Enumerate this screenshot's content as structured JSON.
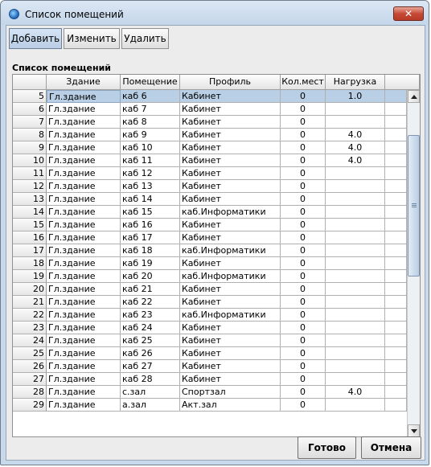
{
  "window": {
    "title": "Список помещений",
    "close_label": "✕"
  },
  "toolbar": {
    "add_label": "Добавить",
    "edit_label": "Изменить",
    "delete_label": "Удалить"
  },
  "group_label": "Список помещений",
  "table": {
    "columns": [
      "",
      "Здание",
      "Помещение",
      "Профиль",
      "Кол.мест",
      "Нагрузка"
    ],
    "selected_row": 0,
    "rows": [
      {
        "num": "5",
        "building": "Гл.здание",
        "room": "каб 6",
        "profile": "Кабинет",
        "seats": "0",
        "load": "1.0"
      },
      {
        "num": "6",
        "building": "Гл.здание",
        "room": "каб 7",
        "profile": "Кабинет",
        "seats": "0",
        "load": ""
      },
      {
        "num": "7",
        "building": "Гл.здание",
        "room": "каб 8",
        "profile": "Кабинет",
        "seats": "0",
        "load": ""
      },
      {
        "num": "8",
        "building": "Гл.здание",
        "room": "каб 9",
        "profile": "Кабинет",
        "seats": "0",
        "load": "4.0"
      },
      {
        "num": "9",
        "building": "Гл.здание",
        "room": "каб 10",
        "profile": "Кабинет",
        "seats": "0",
        "load": "4.0"
      },
      {
        "num": "10",
        "building": "Гл.здание",
        "room": "каб 11",
        "profile": "Кабинет",
        "seats": "0",
        "load": "4.0"
      },
      {
        "num": "11",
        "building": "Гл.здание",
        "room": "каб 12",
        "profile": "Кабинет",
        "seats": "0",
        "load": ""
      },
      {
        "num": "12",
        "building": "Гл.здание",
        "room": "каб 13",
        "profile": "Кабинет",
        "seats": "0",
        "load": ""
      },
      {
        "num": "13",
        "building": "Гл.здание",
        "room": "каб 14",
        "profile": "Кабинет",
        "seats": "0",
        "load": ""
      },
      {
        "num": "14",
        "building": "Гл.здание",
        "room": "каб 15",
        "profile": "каб.Информатики",
        "seats": "0",
        "load": ""
      },
      {
        "num": "15",
        "building": "Гл.здание",
        "room": "каб 16",
        "profile": "Кабинет",
        "seats": "0",
        "load": ""
      },
      {
        "num": "16",
        "building": "Гл.здание",
        "room": "каб 17",
        "profile": "Кабинет",
        "seats": "0",
        "load": ""
      },
      {
        "num": "17",
        "building": "Гл.здание",
        "room": "каб 18",
        "profile": "каб.Информатики",
        "seats": "0",
        "load": ""
      },
      {
        "num": "18",
        "building": "Гл.здание",
        "room": "каб 19",
        "profile": "Кабинет",
        "seats": "0",
        "load": ""
      },
      {
        "num": "19",
        "building": "Гл.здание",
        "room": "каб 20",
        "profile": "каб.Информатики",
        "seats": "0",
        "load": ""
      },
      {
        "num": "20",
        "building": "Гл.здание",
        "room": "каб 21",
        "profile": "Кабинет",
        "seats": "0",
        "load": ""
      },
      {
        "num": "21",
        "building": "Гл.здание",
        "room": "каб 22",
        "profile": "Кабинет",
        "seats": "0",
        "load": ""
      },
      {
        "num": "22",
        "building": "Гл.здание",
        "room": "каб 23",
        "profile": "каб.Информатики",
        "seats": "0",
        "load": ""
      },
      {
        "num": "23",
        "building": "Гл.здание",
        "room": "каб 24",
        "profile": "Кабинет",
        "seats": "0",
        "load": ""
      },
      {
        "num": "24",
        "building": "Гл.здание",
        "room": "каб 25",
        "profile": "Кабинет",
        "seats": "0",
        "load": ""
      },
      {
        "num": "25",
        "building": "Гл.здание",
        "room": "каб 26",
        "profile": "Кабинет",
        "seats": "0",
        "load": ""
      },
      {
        "num": "26",
        "building": "Гл.здание",
        "room": "каб 27",
        "profile": "Кабинет",
        "seats": "0",
        "load": ""
      },
      {
        "num": "27",
        "building": "Гл.здание",
        "room": "каб 28",
        "profile": "Кабинет",
        "seats": "0",
        "load": ""
      },
      {
        "num": "28",
        "building": "Гл.здание",
        "room": "с.зал",
        "profile": "Спортзал",
        "seats": "0",
        "load": "4.0"
      },
      {
        "num": "29",
        "building": "Гл.здание",
        "room": "а.зал",
        "profile": "Акт.зал",
        "seats": "0",
        "load": ""
      }
    ]
  },
  "footer": {
    "ok_label": "Готово",
    "cancel_label": "Отмена"
  },
  "colors": {
    "selection": "#b8cfe5",
    "window_frame": "#c8d9ec",
    "close_button": "#c74a37"
  },
  "icons": {
    "app": "app-globe-icon",
    "close": "close-icon",
    "scroll_up": "scroll-up-arrow-icon",
    "scroll_down": "scroll-down-arrow-icon"
  }
}
